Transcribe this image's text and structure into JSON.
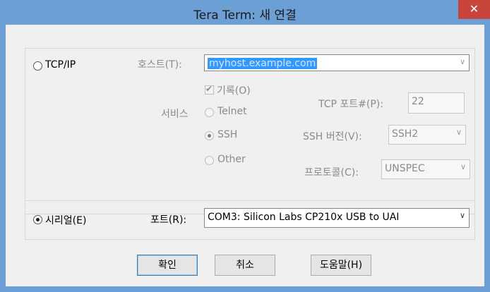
{
  "window": {
    "title": "Tera Term: 새 연결",
    "close_symbol": "✕"
  },
  "tcpip": {
    "label": "TCP/IP",
    "host_label": "호스트(T):",
    "host_value": "myhost.example.com",
    "history_label": "기록(O)",
    "service_label": "서비스",
    "telnet_label": "Telnet",
    "ssh_label": "SSH",
    "other_label": "Other",
    "tcp_port_label": "TCP 포트#(P):",
    "tcp_port_value": "22",
    "ssh_version_label": "SSH 버전(V):",
    "ssh_version_value": "SSH2",
    "protocol_label": "프로토콜(C):",
    "protocol_value": "UNSPEC"
  },
  "serial": {
    "label": "시리얼(E)",
    "port_label": "포트(R):",
    "port_value": "COM3: Silicon Labs CP210x USB to UAI"
  },
  "buttons": {
    "ok": "확인",
    "cancel": "취소",
    "help": "도움말(H)"
  },
  "colors": {
    "titlebar": "#6c9fd6",
    "close": "#c7453a",
    "selection": "#3399ff"
  }
}
